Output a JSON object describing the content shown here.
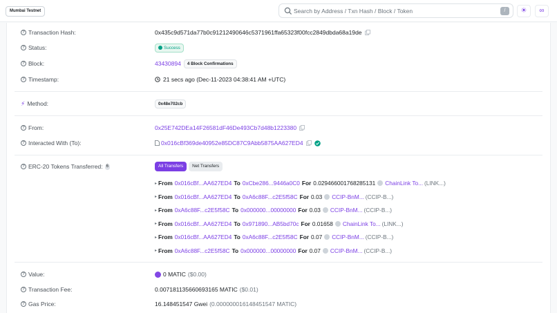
{
  "header": {
    "network_badge": "Mumbai Testnet",
    "search_placeholder": "Search by Address / Txn Hash / Block / Token",
    "slash_key": "/"
  },
  "fields": {
    "tx_hash": {
      "label": "Transaction Hash:",
      "value": "0x435c9d571da77b0c91212490646c5371961ffa65323f00fcc2849dbda68a19de"
    },
    "status": {
      "label": "Status:",
      "value": "Success"
    },
    "block": {
      "label": "Block:",
      "value": "43430894",
      "confirmations": "4 Block Confirmations"
    },
    "timestamp": {
      "label": "Timestamp:",
      "value": "21 secs ago (Dec-11-2023 04:38:41 AM +UTC)"
    },
    "method": {
      "label": "Method:",
      "value": "0x48e702cb"
    },
    "from": {
      "label": "From:",
      "value": "0x25E742DEa14F26581dF46De493Cb7d48b1223380"
    },
    "interacted": {
      "label": "Interacted With (To):",
      "value": "0x016cBf369de40952e85DC87C9Abb5875AA627ED4"
    },
    "erc20": {
      "label": "ERC-20 Tokens Transferred:",
      "count": "6",
      "tab_all": "All Transfers",
      "tab_net": "Net Transfers"
    },
    "value": {
      "label": "Value:",
      "amount": "0 MATIC",
      "usd": "($0.00)"
    },
    "fee": {
      "label": "Transaction Fee:",
      "amount": "0.007181135660693165 MATIC",
      "usd": "($0.01)"
    },
    "gas_price": {
      "label": "Gas Price:",
      "amount": "16.148451547 Gwei",
      "detail": "(0.000000016148451547 MATIC)"
    }
  },
  "transfers": [
    {
      "from_kw": "From",
      "from": "0x016cBf...AA627ED4",
      "to_kw": "To",
      "to": "0xCbe286...9446a0C0",
      "for_kw": "For",
      "amount": "0.029466001768285131",
      "token": "ChainLink To...",
      "symbol": "(LINK...)"
    },
    {
      "from_kw": "From",
      "from": "0x016cBf...AA627ED4",
      "to_kw": "To",
      "to": "0xA6c88F...c2E5f58C",
      "for_kw": "For",
      "amount": "0.03",
      "token": "CCIP-BnM...",
      "symbol": "(CCIP-B...)"
    },
    {
      "from_kw": "From",
      "from": "0xA6c88F...c2E5f58C",
      "to_kw": "To",
      "to": "0x000000...00000000",
      "for_kw": "For",
      "amount": "0.03",
      "token": "CCIP-BnM...",
      "symbol": "(CCIP-B...)"
    },
    {
      "from_kw": "From",
      "from": "0x016cBf...AA627ED4",
      "to_kw": "To",
      "to": "0x971890...AB5bd70c",
      "for_kw": "For",
      "amount": "0.01658",
      "token": "ChainLink To...",
      "symbol": "(LINK...)"
    },
    {
      "from_kw": "From",
      "from": "0x016cBf...AA627ED4",
      "to_kw": "To",
      "to": "0xA6c88F...c2E5f58C",
      "for_kw": "For",
      "amount": "0.07",
      "token": "CCIP-BnM...",
      "symbol": "(CCIP-B...)"
    },
    {
      "from_kw": "From",
      "from": "0xA6c88F...c2E5f58C",
      "to_kw": "To",
      "to": "0x000000...00000000",
      "for_kw": "For",
      "amount": "0.07",
      "token": "CCIP-BnM...",
      "symbol": "(CCIP-B...)"
    }
  ],
  "icons": {
    "search": "search-icon",
    "theme": "sun-icon",
    "network": "link-icon",
    "help": "question-circle-icon",
    "copy": "copy-icon",
    "clock": "clock-icon",
    "method": "lightning-icon",
    "contract": "file-icon",
    "verified": "check-circle-icon"
  },
  "colors": {
    "accent": "#7b3fe4",
    "success": "#00a186",
    "verified": "#00a186"
  }
}
